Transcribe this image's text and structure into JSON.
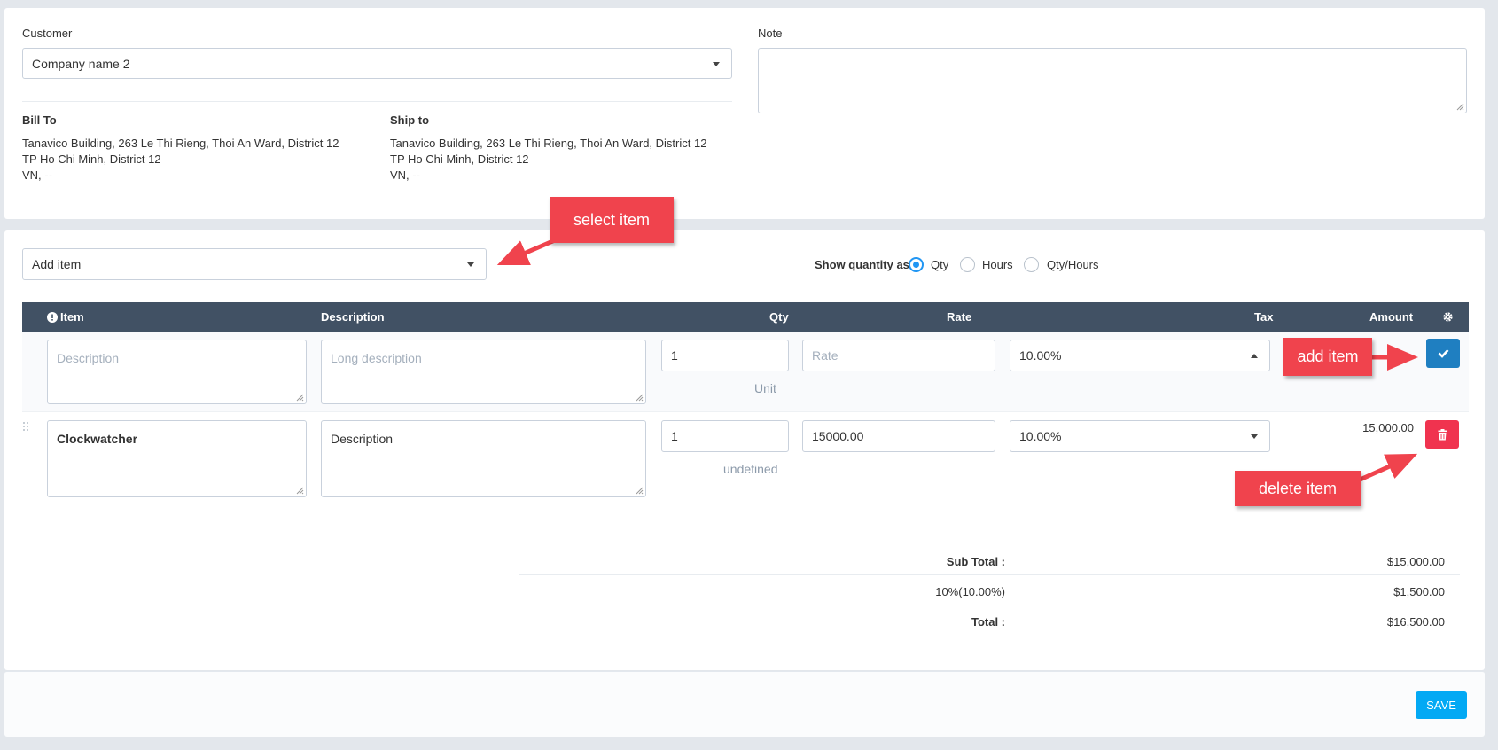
{
  "customer": {
    "label": "Customer",
    "value": "Company name 2"
  },
  "note": {
    "label": "Note",
    "value": ""
  },
  "bill_to": {
    "title": "Bill To",
    "line1": "Tanavico Building, 263 Le Thi Rieng, Thoi An Ward, District 12",
    "line2": "TP Ho Chi Minh, District 12",
    "line3": "VN, --"
  },
  "ship_to": {
    "title": "Ship to",
    "line1": "Tanavico Building, 263 Le Thi Rieng, Thoi An Ward, District 12",
    "line2": "TP Ho Chi Minh, District 12",
    "line3": "VN, --"
  },
  "add_item": {
    "placeholder": "Add item"
  },
  "quantity_mode": {
    "label": "Show quantity as:",
    "options": [
      "Qty",
      "Hours",
      "Qty/Hours"
    ],
    "selected": "Qty"
  },
  "table": {
    "headers": {
      "item": "Item",
      "description": "Description",
      "qty": "Qty",
      "rate": "Rate",
      "tax": "Tax",
      "amount": "Amount"
    }
  },
  "new_row": {
    "description_placeholder": "Description",
    "long_description_placeholder": "Long description",
    "qty": "1",
    "unit": "Unit",
    "rate_placeholder": "Rate",
    "tax": "10.00%"
  },
  "item_row": {
    "name": "Clockwatcher",
    "description": "Description",
    "qty": "1",
    "unit": "undefined",
    "rate": "15000.00",
    "tax": "10.00%",
    "amount": "15,000.00"
  },
  "totals": {
    "subtotal_label": "Sub Total :",
    "subtotal_value": "$15,000.00",
    "tax_label": "10%(10.00%)",
    "tax_value": "$1,500.00",
    "total_label": "Total :",
    "total_value": "$16,500.00"
  },
  "save_label": "SAVE",
  "annotations": {
    "select_item": "select item",
    "add_item": "add item",
    "delete_item": "delete item"
  },
  "colors": {
    "header": "#415164",
    "primary_button": "#1f7fc1",
    "danger_button": "#f0334f",
    "save_button": "#03a9f4",
    "callout": "#f0434d",
    "radio": "#2196f3"
  }
}
